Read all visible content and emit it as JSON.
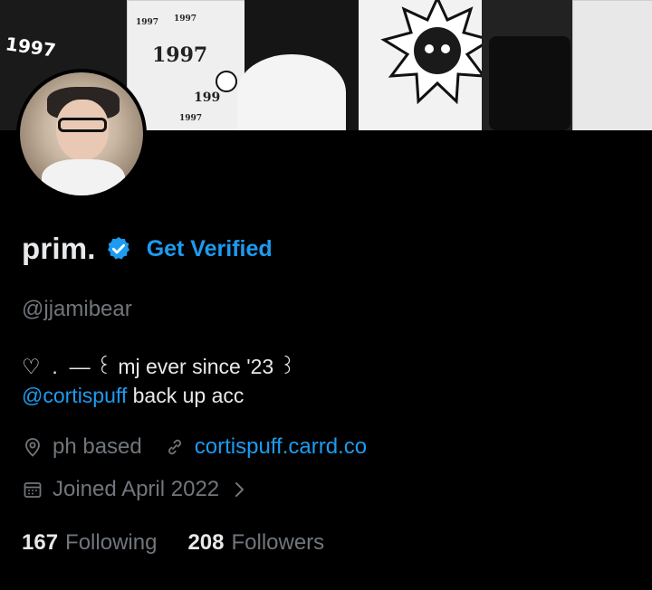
{
  "banner": {
    "texts": [
      "1997",
      "1997",
      "1997",
      "1997",
      "199",
      "1997"
    ]
  },
  "profile": {
    "display_name": "prim.",
    "verified_cta": "Get Verified",
    "handle": "@jjamibear",
    "bio_line1": "♡  .  — ꒰ mj ever since '23 ꒱",
    "bio_mention": "@cortispuff",
    "bio_line2_rest": " back up acc",
    "location": "ph based",
    "website": "cortispuff.carrd.co",
    "joined": "Joined April 2022",
    "following_count": "167",
    "following_label": "Following",
    "followers_count": "208",
    "followers_label": "Followers"
  },
  "colors": {
    "background": "#000000",
    "text": "#e7e9ea",
    "muted": "#71767b",
    "accent": "#1d9bf0"
  },
  "icons": {
    "verified": "verified-badge-icon",
    "location": "location-pin-icon",
    "link": "link-icon",
    "calendar": "calendar-icon",
    "chevron": "chevron-right-icon"
  }
}
